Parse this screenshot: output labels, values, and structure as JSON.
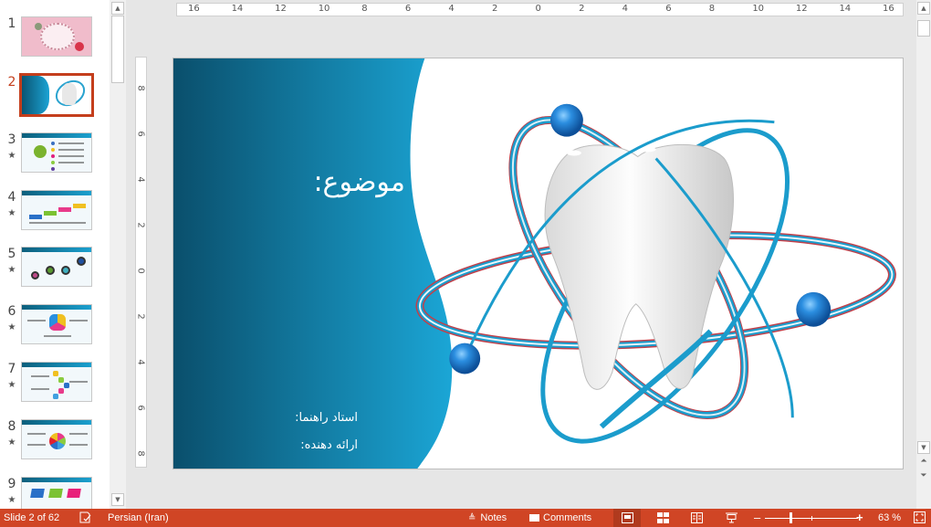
{
  "thumbnails": [
    {
      "number": "1",
      "star": "",
      "style": "floral"
    },
    {
      "number": "2",
      "star": "",
      "style": "tooth-title",
      "active": true
    },
    {
      "number": "3",
      "star": "★",
      "style": "list"
    },
    {
      "number": "4",
      "star": "★",
      "style": "steps"
    },
    {
      "number": "5",
      "star": "★",
      "style": "circles"
    },
    {
      "number": "6",
      "star": "★",
      "style": "hexagon"
    },
    {
      "number": "7",
      "star": "★",
      "style": "hexes"
    },
    {
      "number": "8",
      "star": "★",
      "style": "flower"
    },
    {
      "number": "9",
      "star": "★",
      "style": "tags"
    }
  ],
  "ruler": {
    "horizontal": [
      "16",
      "14",
      "12",
      "10",
      "8",
      "6",
      "4",
      "2",
      "0",
      "2",
      "4",
      "6",
      "8",
      "10",
      "12",
      "14",
      "16"
    ],
    "vertical": [
      "8",
      "6",
      "4",
      "2",
      "0",
      "2",
      "4",
      "6",
      "8"
    ]
  },
  "slide": {
    "title": "موضوع:",
    "advisor": "استاد راهنما:",
    "presenter": "ارائه دهنده:",
    "colors": {
      "panel_dark": "#0a5573",
      "panel_light": "#1ba3d4",
      "orbit_blue": "#1b9ccc",
      "orbit_red": "#c0404a",
      "atom_ball": "#1f7fc8"
    }
  },
  "statusbar": {
    "slide_info": "Slide 2 of 62",
    "language": "Persian (Iran)",
    "notes_label": "Notes",
    "comments_label": "Comments",
    "zoom_percent": "63 %",
    "zoom_level_fraction": 0.63,
    "accent_color": "#d04525"
  },
  "icons": {
    "spellcheck": "spell-check-icon",
    "notes": "notes-icon",
    "comments": "comment-icon",
    "normal_view": "normal-view-icon",
    "sorter_view": "slide-sorter-icon",
    "reading_view": "reading-view-icon",
    "slideshow": "slideshow-icon",
    "fit": "fit-to-window-icon"
  }
}
